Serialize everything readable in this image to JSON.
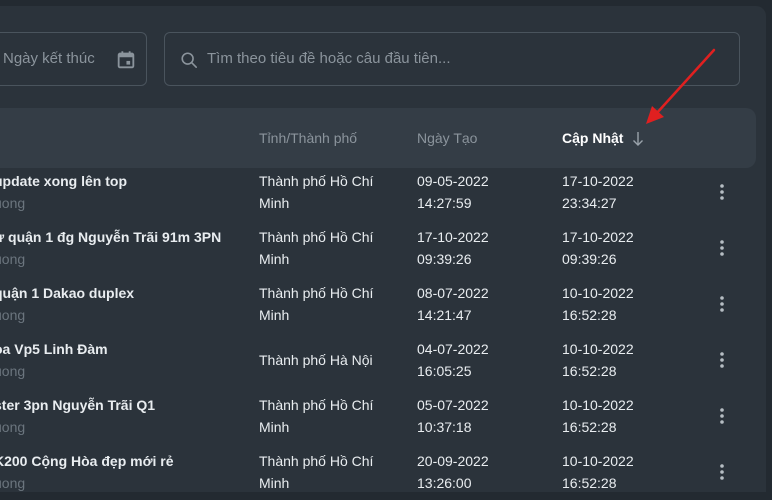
{
  "filters": {
    "end_date_placeholder": "Ngày kết thúc",
    "search_placeholder": "Tìm theo tiêu đề hoặc câu đầu tiên..."
  },
  "table": {
    "columns": [
      "Tỉnh/Thành phố",
      "Ngày Tạo",
      "Cập Nhật"
    ],
    "sorted_column": "Cập Nhật",
    "sort_direction": "desc",
    "rows": [
      {
        "title": "update xong lên top",
        "subtitle": "uong",
        "city": [
          "Thành phố Hồ Chí",
          "Minh"
        ],
        "created": [
          "09-05-2022",
          "14:27:59"
        ],
        "updated": [
          "17-10-2022",
          "23:34:27"
        ]
      },
      {
        "title": "ư quận 1 đg Nguyễn Trãi 91m 3PN",
        "subtitle": "uong",
        "city": [
          "Thành phố Hồ Chí",
          "Minh"
        ],
        "created": [
          "17-10-2022",
          "09:39:26"
        ],
        "updated": [
          "17-10-2022",
          "09:39:26"
        ]
      },
      {
        "title": "quận 1 Dakao duplex",
        "subtitle": "uong",
        "city": [
          "Thành phố Hồ Chí",
          "Minh"
        ],
        "created": [
          "08-07-2022",
          "14:21:47"
        ],
        "updated": [
          "10-10-2022",
          "16:52:28"
        ]
      },
      {
        "title": "òa Vp5 Linh Đàm",
        "subtitle": "uong",
        "city": [
          "Thành phố Hà Nội",
          ""
        ],
        "created": [
          "04-07-2022",
          "16:05:25"
        ],
        "updated": [
          "10-10-2022",
          "16:52:28"
        ]
      },
      {
        "title": "ster 3pn Nguyễn Trãi Q1",
        "subtitle": "uong",
        "city": [
          "Thành phố Hồ Chí",
          "Minh"
        ],
        "created": [
          "05-07-2022",
          "10:37:18"
        ],
        "updated": [
          "10-10-2022",
          "16:52:28"
        ]
      },
      {
        "title": "K200 Cộng Hòa đẹp mới rẻ",
        "subtitle": "uong",
        "city": [
          "Thành phố Hồ Chí",
          "Minh"
        ],
        "created": [
          "20-09-2022",
          "13:26:00"
        ],
        "updated": [
          "10-10-2022",
          "16:52:28"
        ]
      }
    ]
  },
  "icons": {
    "calendar": "calendar-icon",
    "search": "search-icon",
    "sort": "arrow-down-icon",
    "row_menu": "more-vertical-icon"
  },
  "colors": {
    "background": "#2b333b",
    "header": "#343d46",
    "annotation_arrow": "#e02020"
  }
}
